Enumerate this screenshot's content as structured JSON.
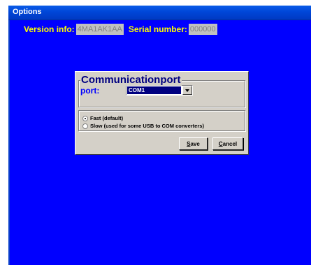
{
  "window": {
    "title": "Options"
  },
  "info": {
    "version_label": "Version info:",
    "version_value": "4MA1AK1AA",
    "serial_label": "Serial number:",
    "serial_value": "000000"
  },
  "dialog": {
    "title": "Communicationport",
    "port_label": "port:",
    "port_value": "COM1",
    "speed_options": [
      {
        "label": "Fast (default)",
        "selected": true
      },
      {
        "label": "Slow (used for some USB to COM converters)",
        "selected": false
      }
    ],
    "save_accel": "S",
    "save_rest": "ave",
    "cancel_accel": "C",
    "cancel_rest": "ancel"
  },
  "colors": {
    "background": "#0000ff",
    "info_text": "#ffff00",
    "dialog_face": "#d4d0c8",
    "dialog_title": "#000080",
    "port_label": "#0000ff"
  }
}
